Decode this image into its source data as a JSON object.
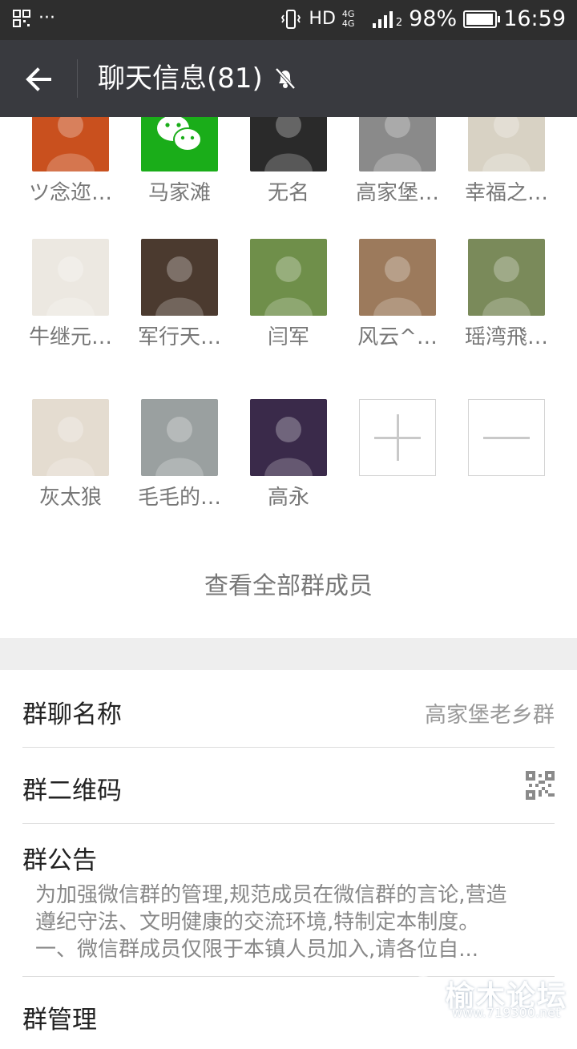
{
  "status_bar": {
    "network": "HD",
    "network_type": "4G 4G",
    "sim_slot": "2",
    "battery": "98%",
    "battery_level": 0.98,
    "time": "16:59"
  },
  "header": {
    "title": "聊天信息(81)"
  },
  "members": [
    {
      "name": "ツ念迩…",
      "avatar_color": "#c9501e"
    },
    {
      "name": "马家滩",
      "avatar_color": "#1aad19"
    },
    {
      "name": "无名",
      "avatar_color": "#2a2a2a"
    },
    {
      "name": "高家堡…",
      "avatar_color": "#8a8a8a"
    },
    {
      "name": "幸福之…",
      "avatar_color": "#d8d2c4"
    },
    {
      "name": "牛继元…",
      "avatar_color": "#ece8e1"
    },
    {
      "name": "军行天…",
      "avatar_color": "#4b3a2f"
    },
    {
      "name": "闫军",
      "avatar_color": "#6f8f4a"
    },
    {
      "name": "风云^…",
      "avatar_color": "#9c7a5c"
    },
    {
      "name": "瑶湾飛…",
      "avatar_color": "#7a8a5a"
    },
    {
      "name": "灰太狼",
      "avatar_color": "#e4dcd0"
    },
    {
      "name": "毛毛的…",
      "avatar_color": "#9aa0a0"
    },
    {
      "name": "高永",
      "avatar_color": "#3a2a4a"
    }
  ],
  "view_all_label": "查看全部群成员",
  "settings": {
    "group_name_label": "群聊名称",
    "group_name_value": "高家堡老乡群",
    "qr_label": "群二维码",
    "notice_label": "群公告",
    "notice_lines": [
      "为加强微信群的管理,规范成员在微信群的言论,营造",
      "遵纪守法、文明健康的交流环境,特制定本制度。",
      "一、微信群成员仅限于本镇人员加入,请各位自..."
    ],
    "manage_label": "群管理"
  },
  "watermark": {
    "text": "榆木论坛",
    "url": "www.719300.net"
  },
  "colors": {
    "status_bar": "#2e2e2e",
    "title_bar": "#393a3f",
    "section_gap": "#eeeeee",
    "wechat_green": "#1aad19"
  }
}
